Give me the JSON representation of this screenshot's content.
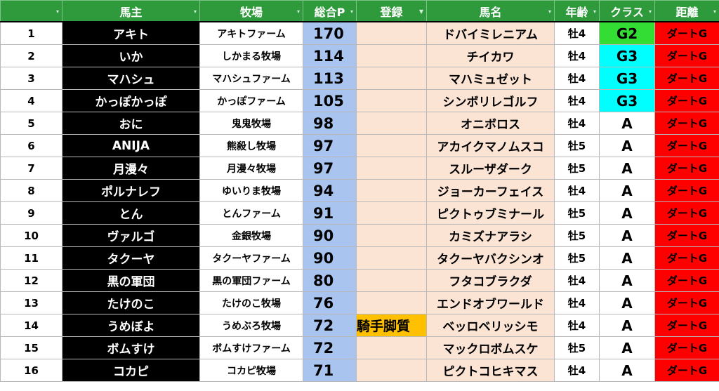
{
  "header": {
    "rank": "",
    "owner": "馬主",
    "ranch": "牧場",
    "points": "総合P",
    "registration": "登録",
    "horse": "馬名",
    "age": "年齢",
    "class": "クラス",
    "distance": "距離"
  },
  "colors": {
    "header_bg": "#2e9a3c",
    "owner_bg": "#000000",
    "points_bg": "#a9c4ef",
    "horse_bg": "#fbe4d4",
    "class_g2": "#33dd33",
    "class_g3": "#00ffff",
    "distance_bg": "#ff0000",
    "registration_highlight": "#ffc000"
  },
  "rows": [
    {
      "rank": "1",
      "owner": "アキト",
      "ranch": "アキトファーム",
      "points": "170",
      "reg": "",
      "horse": "ドバイミレニアム",
      "age": "牡4",
      "cls": "G2",
      "cls_color": "#33dd33",
      "dist": "ダートG"
    },
    {
      "rank": "2",
      "owner": "いか",
      "ranch": "しかまる牧場",
      "points": "114",
      "reg": "",
      "horse": "チイカワ",
      "age": "牡4",
      "cls": "G3",
      "cls_color": "#00ffff",
      "dist": "ダートG"
    },
    {
      "rank": "3",
      "owner": "マハシュ",
      "ranch": "マハシュファーム",
      "points": "113",
      "reg": "",
      "horse": "マハミュゼット",
      "age": "牡4",
      "cls": "G3",
      "cls_color": "#00ffff",
      "dist": "ダートG"
    },
    {
      "rank": "4",
      "owner": "かっぽかっぽ",
      "ranch": "かっぽファーム",
      "points": "105",
      "reg": "",
      "horse": "シンボリレゴルフ",
      "age": "牡4",
      "cls": "G3",
      "cls_color": "#00ffff",
      "dist": "ダートG"
    },
    {
      "rank": "5",
      "owner": "おに",
      "ranch": "鬼鬼牧場",
      "points": "98",
      "reg": "",
      "horse": "オニボロス",
      "age": "牡4",
      "cls": "A",
      "cls_color": "#ffffff",
      "dist": "ダートG"
    },
    {
      "rank": "6",
      "owner": "ANIJA",
      "ranch": "熊殺し牧場",
      "points": "97",
      "reg": "",
      "horse": "アカイクマノムスコ",
      "age": "牡5",
      "cls": "A",
      "cls_color": "#ffffff",
      "dist": "ダートG"
    },
    {
      "rank": "7",
      "owner": "月漫々",
      "ranch": "月漫々牧場",
      "points": "97",
      "reg": "",
      "horse": "スルーザダーク",
      "age": "牡5",
      "cls": "A",
      "cls_color": "#ffffff",
      "dist": "ダートG"
    },
    {
      "rank": "8",
      "owner": "ポルナレフ",
      "ranch": "ゆいりま牧場",
      "points": "94",
      "reg": "",
      "horse": "ジョーカーフェイス",
      "age": "牡4",
      "cls": "A",
      "cls_color": "#ffffff",
      "dist": "ダートG"
    },
    {
      "rank": "9",
      "owner": "とん",
      "ranch": "とんファーム",
      "points": "91",
      "reg": "",
      "horse": "ピクトゥブミナール",
      "age": "牡5",
      "cls": "A",
      "cls_color": "#ffffff",
      "dist": "ダートG"
    },
    {
      "rank": "10",
      "owner": "ヴァルゴ",
      "ranch": "金銀牧場",
      "points": "90",
      "reg": "",
      "horse": "カミズナアラシ",
      "age": "牡5",
      "cls": "A",
      "cls_color": "#ffffff",
      "dist": "ダートG"
    },
    {
      "rank": "11",
      "owner": "タクーヤ",
      "ranch": "タクーヤファーム",
      "points": "90",
      "reg": "",
      "horse": "タクーヤバクシンオ",
      "age": "牡5",
      "cls": "A",
      "cls_color": "#ffffff",
      "dist": "ダートG"
    },
    {
      "rank": "12",
      "owner": "黒の軍団",
      "ranch": "黒の軍団ファーム",
      "points": "80",
      "reg": "",
      "horse": "フタコブラクダ",
      "age": "牡4",
      "cls": "A",
      "cls_color": "#ffffff",
      "dist": "ダートG"
    },
    {
      "rank": "13",
      "owner": "たけのこ",
      "ranch": "たけのこ牧場",
      "points": "76",
      "reg": "",
      "horse": "エンドオブワールド",
      "age": "牡4",
      "cls": "A",
      "cls_color": "#ffffff",
      "dist": "ダートG"
    },
    {
      "rank": "14",
      "owner": "うめぼよ",
      "ranch": "うめぶろ牧場",
      "points": "72",
      "reg": "騎手脚質",
      "horse": "ベッロベリッシモ",
      "age": "牡4",
      "cls": "A",
      "cls_color": "#ffffff",
      "dist": "ダートG"
    },
    {
      "rank": "15",
      "owner": "ボムすけ",
      "ranch": "ボムすけファーム",
      "points": "72",
      "reg": "",
      "horse": "マックロボムスケ",
      "age": "牡5",
      "cls": "A",
      "cls_color": "#ffffff",
      "dist": "ダートG"
    },
    {
      "rank": "16",
      "owner": "コカピ",
      "ranch": "コカピ牧場",
      "points": "71",
      "reg": "",
      "horse": "ピクトコヒキマス",
      "age": "牡4",
      "cls": "A",
      "cls_color": "#ffffff",
      "dist": "ダートG"
    }
  ]
}
